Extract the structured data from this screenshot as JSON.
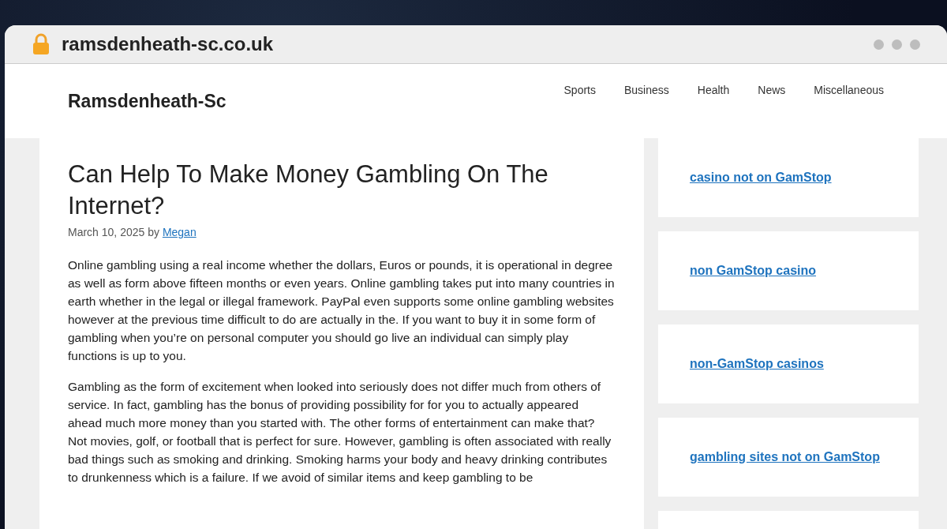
{
  "browser": {
    "url": "ramsdenheath-sc.co.uk"
  },
  "site": {
    "title": "Ramsdenheath-Sc",
    "nav": [
      {
        "label": "Sports"
      },
      {
        "label": "Business"
      },
      {
        "label": "Health"
      },
      {
        "label": "News"
      },
      {
        "label": "Miscellaneous"
      }
    ]
  },
  "article": {
    "title": "Can Help To Make Money Gambling On The Internet?",
    "date": "March 10, 2025",
    "by": "by",
    "author": "Megan",
    "paragraphs": [
      "Online gambling using a real income whether the dollars, Euros or pounds, it is operational in degree as well as form above fifteen months or even years. Online gambling takes put into many countries in earth whether in the legal or illegal framework. PayPal even supports some online gambling websites however at the previous time difficult to do are actually in the. If you want to buy it in some form of gambling when you’re on personal computer you should go live an individual can simply play functions is up to you.",
      "Gambling as the form of excitement when looked into seriously does not differ much from others of service. In fact, gambling has the bonus of providing possibility for for you to actually appeared ahead much more money than you started with. The other forms of entertainment can make that? Not movies, golf, or football that is perfect for sure. However, gambling is often associated with really bad things such as smoking and drinking. Smoking harms your body and heavy drinking contributes to drunkenness which is a failure. If we avoid of similar items and keep gambling to be"
    ]
  },
  "sidebar": {
    "links": [
      {
        "label": "casino not on GamStop"
      },
      {
        "label": "non GamStop casino"
      },
      {
        "label": "non-GamStop casinos"
      },
      {
        "label": "gambling sites not on GamStop"
      }
    ]
  }
}
